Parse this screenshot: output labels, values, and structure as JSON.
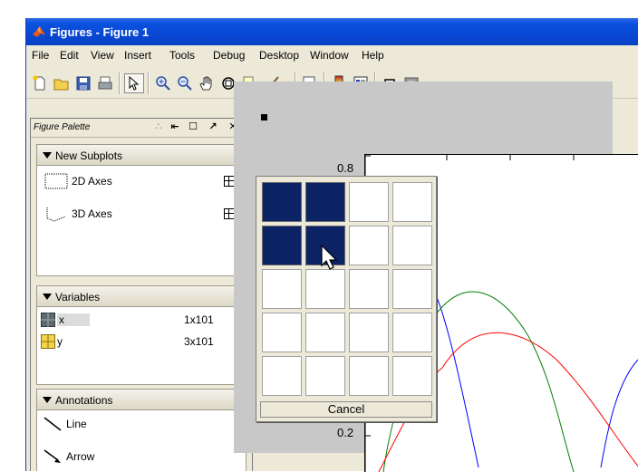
{
  "window": {
    "title": "Figures - Figure 1"
  },
  "menu": [
    "File",
    "Edit",
    "View",
    "Insert",
    "Tools",
    "Debug",
    "Desktop",
    "Window",
    "Help"
  ],
  "toolbar": {
    "buttons": [
      "new-figure-icon",
      "open-file-icon",
      "save-icon",
      "print-icon",
      "select-arrow-icon",
      "zoom-in-icon",
      "zoom-out-icon",
      "pan-hand-icon",
      "rotate-3d-icon",
      "data-cursor-icon",
      "brush-icon",
      "link-plot-icon",
      "colorbar-icon",
      "legend-icon",
      "hide-plot-tools-icon",
      "show-plot-tools-icon"
    ]
  },
  "palette": {
    "title": "Figure Palette",
    "sections": {
      "new_subplots": {
        "label": "New Subplots",
        "items": [
          "2D Axes",
          "3D Axes"
        ]
      },
      "variables": {
        "label": "Variables",
        "rows": [
          {
            "name": "x",
            "size": "1x101"
          },
          {
            "name": "y",
            "size": "3x101"
          }
        ]
      },
      "annotations": {
        "label": "Annotations",
        "items": [
          "Line",
          "Arrow"
        ]
      }
    }
  },
  "axes": {
    "ticks": [
      "0.8",
      "0.2"
    ]
  },
  "subplot_popup": {
    "rows": 5,
    "cols": 4,
    "selected_rows": 2,
    "selected_cols": 2,
    "cancel_label": "Cancel"
  },
  "colors": {
    "title_bar": "#0a52e0",
    "selected_cell": "#0c2366",
    "series": [
      "#0000ff",
      "#008000",
      "#ff0000"
    ]
  }
}
